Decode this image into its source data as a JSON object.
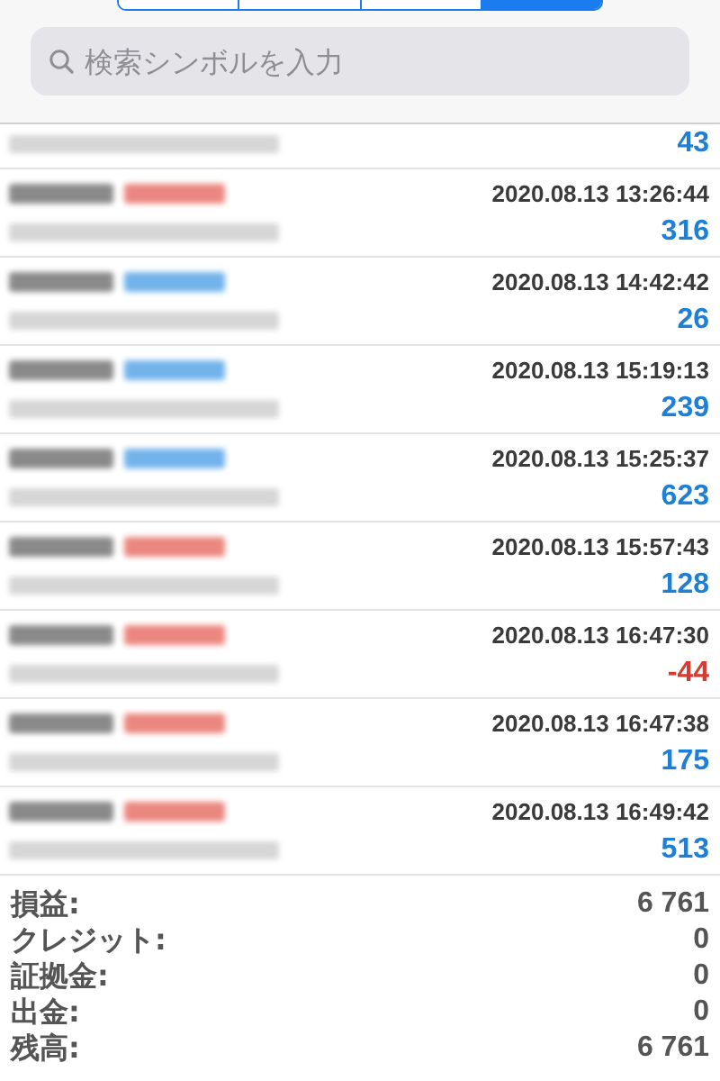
{
  "segments": [
    {
      "selected": false
    },
    {
      "selected": false
    },
    {
      "selected": false
    },
    {
      "selected": true
    }
  ],
  "search": {
    "placeholder": "検索シンボルを入力"
  },
  "first_row": {
    "profit": "43",
    "negative": false
  },
  "deals": [
    {
      "kind": "sell",
      "time": "2020.08.13 13:26:44",
      "profit": "316",
      "negative": false
    },
    {
      "kind": "buy",
      "time": "2020.08.13 14:42:42",
      "profit": "26",
      "negative": false
    },
    {
      "kind": "buy",
      "time": "2020.08.13 15:19:13",
      "profit": "239",
      "negative": false
    },
    {
      "kind": "buy",
      "time": "2020.08.13 15:25:37",
      "profit": "623",
      "negative": false
    },
    {
      "kind": "sell",
      "time": "2020.08.13 15:57:43",
      "profit": "128",
      "negative": false
    },
    {
      "kind": "sell",
      "time": "2020.08.13 16:47:30",
      "profit": "-44",
      "negative": true
    },
    {
      "kind": "sell",
      "time": "2020.08.13 16:47:38",
      "profit": "175",
      "negative": false
    },
    {
      "kind": "sell",
      "time": "2020.08.13 16:49:42",
      "profit": "513",
      "negative": false
    }
  ],
  "summary": [
    {
      "label": "損益:",
      "value": "6 761"
    },
    {
      "label": "クレジット:",
      "value": "0"
    },
    {
      "label": "証拠金:",
      "value": "0"
    },
    {
      "label": "出金:",
      "value": "0"
    },
    {
      "label": "残高:",
      "value": "6 761"
    }
  ]
}
